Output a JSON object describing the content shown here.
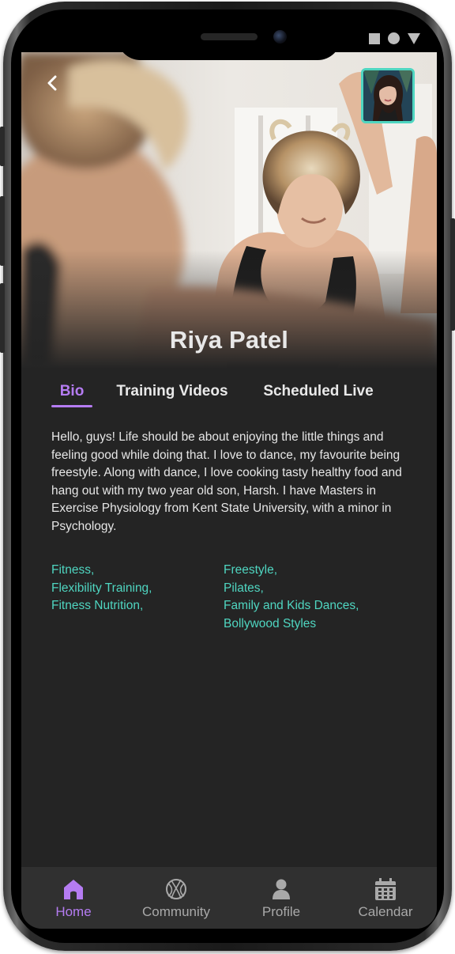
{
  "profile": {
    "name": "Riya Patel"
  },
  "tabs": [
    {
      "label": "Bio",
      "active": true
    },
    {
      "label": "Training Videos",
      "active": false
    },
    {
      "label": "Scheduled Live",
      "active": false
    }
  ],
  "bio": {
    "text": "Hello, guys! Life should be about enjoying the little things and feeling good while doing that. I love to dance, my favourite being freestyle. Along with dance, I love cooking tasty healthy food and hang out with my two year old son, Harsh. I have Masters in Exercise Physiology from Kent State University, with a minor in Psychology."
  },
  "tags": {
    "left": [
      "Fitness,",
      "Flexibility Training,",
      "Fitness Nutrition,"
    ],
    "right": [
      "Freestyle,",
      "Pilates,",
      "Family and Kids Dances,",
      "Bollywood Styles"
    ]
  },
  "bottom_nav": [
    {
      "label": "Home",
      "icon": "home-icon",
      "active": true
    },
    {
      "label": "Community",
      "icon": "globe-icon",
      "active": false
    },
    {
      "label": "Profile",
      "icon": "person-icon",
      "active": false
    },
    {
      "label": "Calendar",
      "icon": "calendar-icon",
      "active": false
    }
  ],
  "colors": {
    "accent": "#b57cf2",
    "tag": "#4fd6c1",
    "background": "#242424",
    "nav_background": "#303030"
  }
}
